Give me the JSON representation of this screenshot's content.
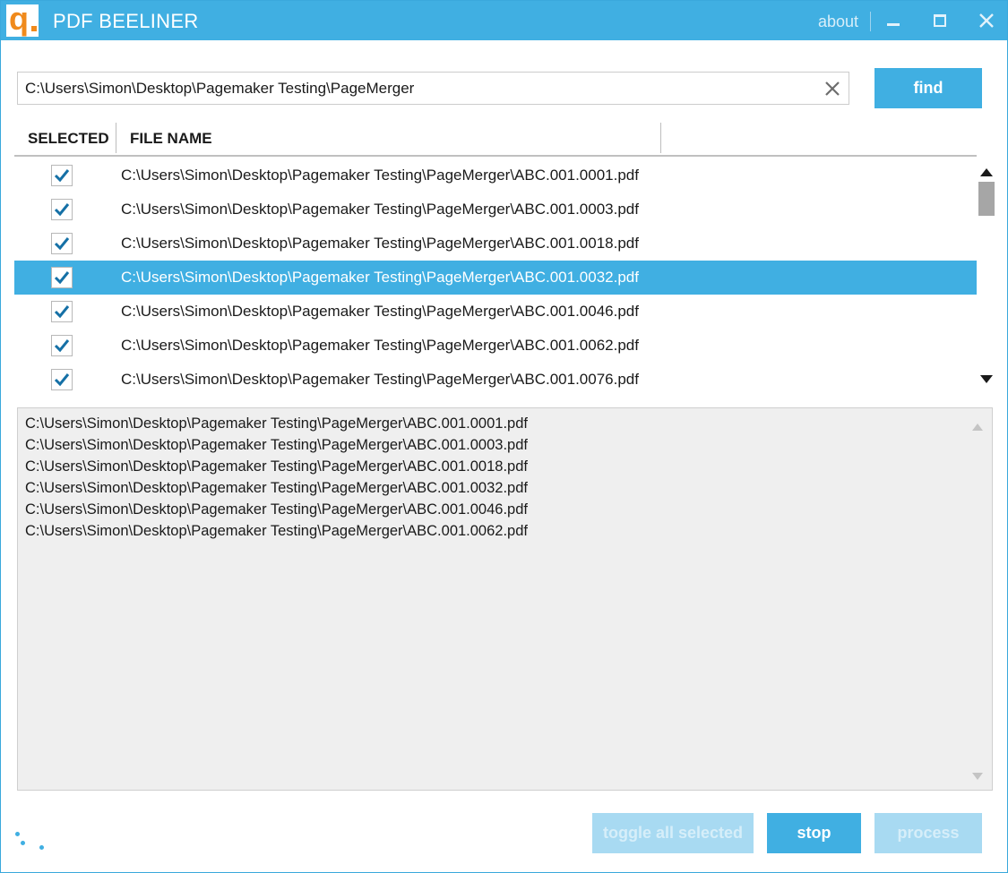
{
  "app": {
    "title": "PDF BEELINER",
    "about_label": "about",
    "accent_color": "#40afe2",
    "logo_color": "#f08a1c",
    "logo_letter": "q"
  },
  "search": {
    "value": "C:\\Users\\Simon\\Desktop\\Pagemaker Testing\\PageMerger",
    "find_label": "find"
  },
  "table": {
    "columns": [
      "SELECTED",
      "FILE NAME"
    ],
    "rows": [
      {
        "checked": true,
        "selected": false,
        "file": "C:\\Users\\Simon\\Desktop\\Pagemaker Testing\\PageMerger\\ABC.001.0001.pdf"
      },
      {
        "checked": true,
        "selected": false,
        "file": "C:\\Users\\Simon\\Desktop\\Pagemaker Testing\\PageMerger\\ABC.001.0003.pdf"
      },
      {
        "checked": true,
        "selected": false,
        "file": "C:\\Users\\Simon\\Desktop\\Pagemaker Testing\\PageMerger\\ABC.001.0018.pdf"
      },
      {
        "checked": true,
        "selected": true,
        "file": "C:\\Users\\Simon\\Desktop\\Pagemaker Testing\\PageMerger\\ABC.001.0032.pdf"
      },
      {
        "checked": true,
        "selected": false,
        "file": "C:\\Users\\Simon\\Desktop\\Pagemaker Testing\\PageMerger\\ABC.001.0046.pdf"
      },
      {
        "checked": true,
        "selected": false,
        "file": "C:\\Users\\Simon\\Desktop\\Pagemaker Testing\\PageMerger\\ABC.001.0062.pdf"
      },
      {
        "checked": true,
        "selected": false,
        "file": "C:\\Users\\Simon\\Desktop\\Pagemaker Testing\\PageMerger\\ABC.001.0076.pdf"
      }
    ]
  },
  "output": {
    "lines": [
      "C:\\Users\\Simon\\Desktop\\Pagemaker Testing\\PageMerger\\ABC.001.0001.pdf",
      "C:\\Users\\Simon\\Desktop\\Pagemaker Testing\\PageMerger\\ABC.001.0003.pdf",
      "C:\\Users\\Simon\\Desktop\\Pagemaker Testing\\PageMerger\\ABC.001.0018.pdf",
      "C:\\Users\\Simon\\Desktop\\Pagemaker Testing\\PageMerger\\ABC.001.0032.pdf",
      "C:\\Users\\Simon\\Desktop\\Pagemaker Testing\\PageMerger\\ABC.001.0046.pdf",
      "C:\\Users\\Simon\\Desktop\\Pagemaker Testing\\PageMerger\\ABC.001.0062.pdf"
    ]
  },
  "buttons": {
    "toggle_label": "toggle all selected",
    "stop_label": "stop",
    "process_label": "process"
  }
}
